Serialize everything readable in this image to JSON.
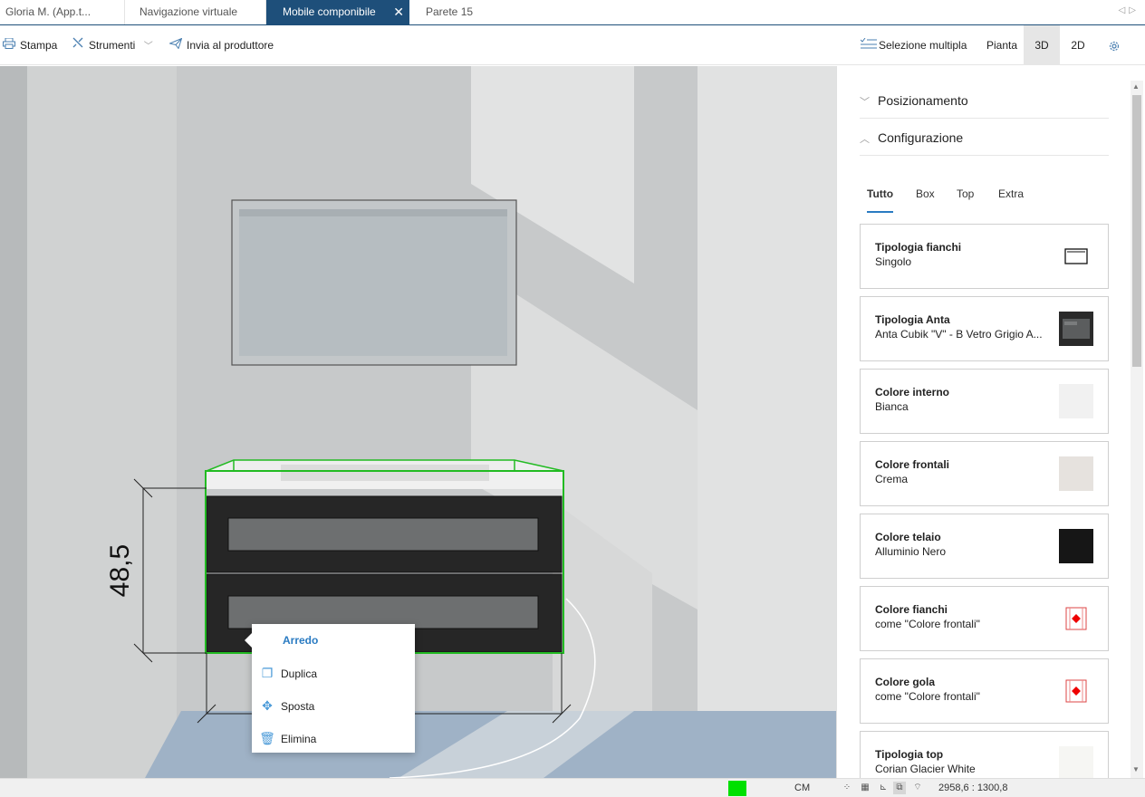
{
  "tabs": [
    {
      "label": "Gloria M. (App.t..."
    },
    {
      "label": "Navigazione virtuale"
    },
    {
      "label": "Mobile componibile",
      "close": "✕"
    },
    {
      "label": "Parete 15"
    }
  ],
  "toolbar": {
    "print_label": "Stampa",
    "tools_label": "Strumenti",
    "send_label": "Invia al produttore",
    "multi_select_label": "Selezione multipla",
    "plan_label": "Pianta",
    "view_3d_label": "3D",
    "view_2d_label": "2D",
    "active_view": "3D"
  },
  "viewport": {
    "dimension_label": "48,5"
  },
  "context_menu": {
    "title": "Arredo",
    "items": [
      {
        "label": "Duplica",
        "icon": "copy-icon"
      },
      {
        "label": "Sposta",
        "icon": "move-icon"
      },
      {
        "label": "Elimina",
        "icon": "trash-icon"
      }
    ]
  },
  "panel": {
    "sections": [
      {
        "label": "Posizionamento",
        "expanded": false
      },
      {
        "label": "Configurazione",
        "expanded": true
      }
    ],
    "subtabs": [
      {
        "label": "Tutto",
        "active": true
      },
      {
        "label": "Box"
      },
      {
        "label": "Top"
      },
      {
        "label": "Extra"
      }
    ],
    "cards": [
      {
        "title": "Tipologia fianchi",
        "value": "Singolo",
        "swatch": "outline-rect"
      },
      {
        "title": "Tipologia Anta",
        "value": "Anta Cubik \"V\" - B Vetro Grigio A...",
        "swatch": "image-dark"
      },
      {
        "title": "Colore interno",
        "value": "Bianca",
        "swatch": "#f1f1f1"
      },
      {
        "title": "Colore frontali",
        "value": "Crema",
        "swatch": "#e6e2de"
      },
      {
        "title": "Colore telaio",
        "value": "Alluminio Nero",
        "swatch": "#161616"
      },
      {
        "title": "Colore fianchi",
        "value": "come \"Colore frontali\"",
        "swatch": "linked-red"
      },
      {
        "title": "Colore gola",
        "value": "come \"Colore frontali\"",
        "swatch": "linked-red"
      },
      {
        "title": "Tipologia top",
        "value": "Corian Glacier White",
        "swatch": "#f6f6f3"
      }
    ]
  },
  "status": {
    "unit": "CM",
    "coords": "2958,6 : 1300,8",
    "indicator_color": "#00e000"
  }
}
